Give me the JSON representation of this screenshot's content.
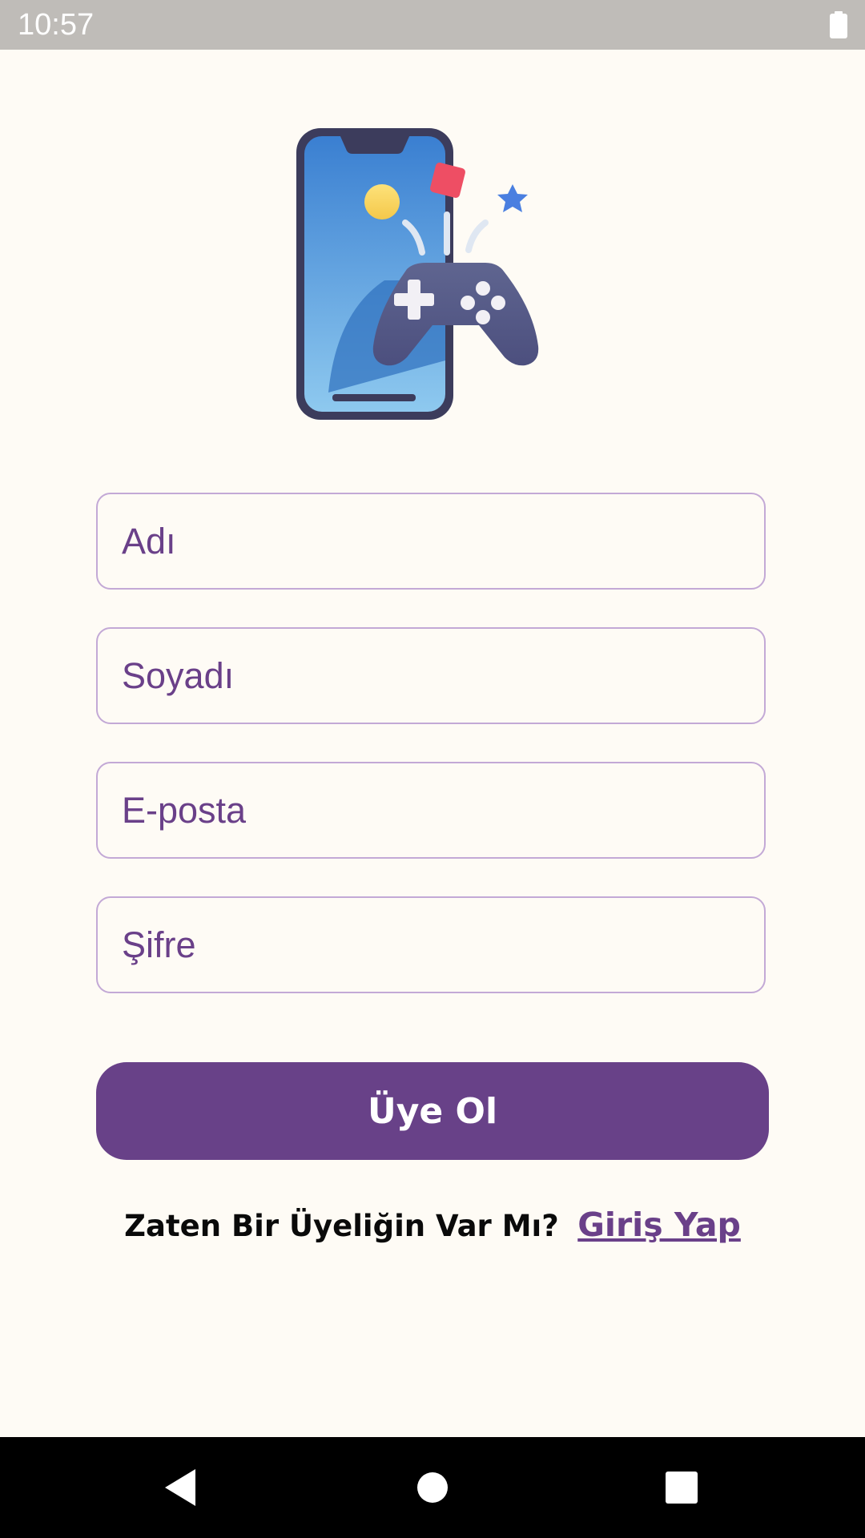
{
  "status_bar": {
    "time": "10:57",
    "battery_icon": "battery-full-icon"
  },
  "hero": {
    "icon": "phone-gamepad-illustration"
  },
  "form": {
    "first_name_placeholder": "Adı",
    "last_name_placeholder": "Soyadı",
    "email_placeholder": "E-posta",
    "password_placeholder": "Şifre",
    "submit_label": "Üye Ol"
  },
  "login": {
    "prompt": "Zaten Bir Üyeliğin Var Mı?",
    "link_label": "Giriş Yap"
  },
  "nav_bar": {
    "back_icon": "back-triangle-icon",
    "home_icon": "home-circle-icon",
    "recents_icon": "recents-square-icon"
  },
  "colors": {
    "background": "#fefbf5",
    "accent": "#684188",
    "field_border": "#c3a9d6",
    "placeholder": "#6a4089",
    "status_bar": "#bfbcb8"
  }
}
